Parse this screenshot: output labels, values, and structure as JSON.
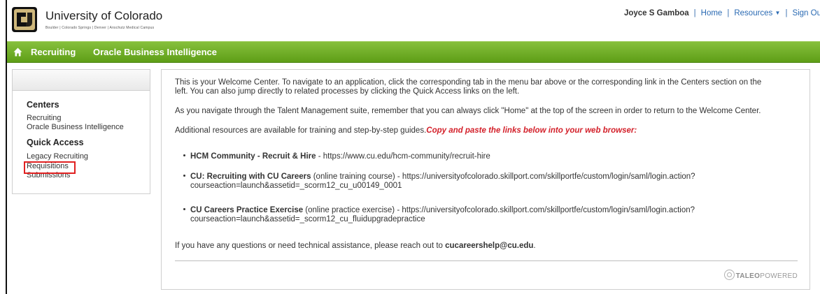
{
  "header": {
    "university": "University of Colorado",
    "campuses": "Boulder | Colorado Springs | Denver | Anschutz Medical Campus",
    "logo_icon": "cu-logo-icon",
    "user": "Joyce S Gamboa",
    "home": "Home",
    "resources": "Resources",
    "sign_out": "Sign Ou"
  },
  "menubar": {
    "home_icon": "home-icon",
    "items": [
      "Recruiting",
      "Oracle Business Intelligence"
    ],
    "color": "#6aa823"
  },
  "sidebar": {
    "centers_title": "Centers",
    "centers": [
      "Recruiting",
      "Oracle Business Intelligence"
    ],
    "quick_title": "Quick Access",
    "quick": [
      "Legacy Recruiting",
      "Requisitions",
      "Submissions"
    ],
    "highlight_color": "#e02020"
  },
  "main": {
    "p1_line1": "This is your Welcome Center. To navigate to an application, click the corresponding tab in the menu bar above or the corresponding link in the Centers section on the",
    "p1_line2": "left. You can also jump directly to related processes by clicking the Quick Access links on the left.",
    "p2": "As you navigate through the Talent Management suite, remember that you can always click \"Home\" at the top of the screen in order to return to the Welcome Center.",
    "p3": "Additional resources are available for training and step-by-step guides.",
    "p3_red": "Copy and paste the links below into your web browser:",
    "b1_bold": "HCM Community - Recruit & Hire",
    "b1_rest": " - https://www.cu.edu/hcm-community/recruit-hire",
    "b2_bold": "CU: Recruiting with CU Careers",
    "b2_rest": " (online training course) - https://universityofcolorado.skillport.com/skillportfe/custom/login/saml/login.action?",
    "b2_line2": "courseaction=launch&assetid=_scorm12_cu_u00149_0001",
    "b3_bold": "CU Careers Practice Exercise",
    "b3_rest": " (online practice exercise) - https://universityofcolorado.skillport.com/skillportfe/custom/login/saml/login.action?",
    "b3_line2": "courseaction=launch&assetid=_scorm12_cu_fluidupgradepractice",
    "help_pre": "If you have any questions or need technical assistance, please reach out to ",
    "help_email": "cucareershelp@cu.edu",
    "help_post": ".",
    "taleo_a": "TALEO",
    "taleo_b": "POWERED"
  }
}
